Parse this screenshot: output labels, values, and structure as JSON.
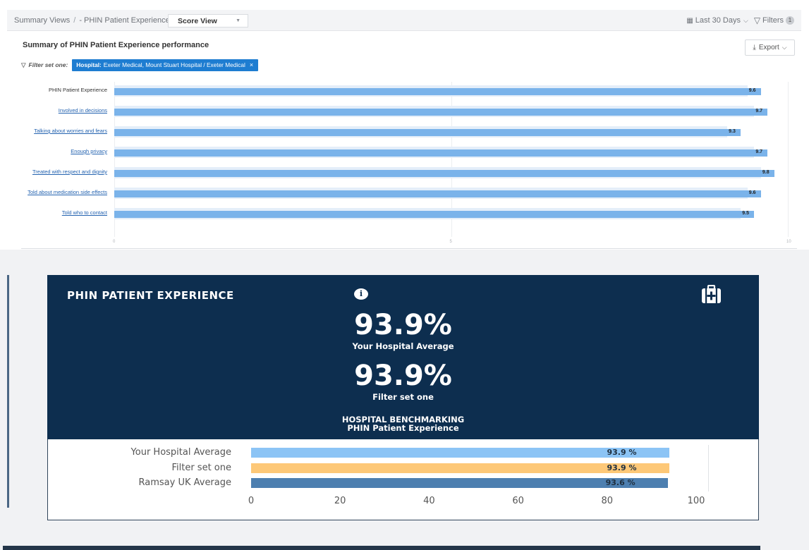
{
  "breadcrumb": {
    "root": "Summary Views",
    "sep": "/",
    "section": "- PHIN Patient Experience",
    "view_select": "Score View"
  },
  "toolbar": {
    "date_range": "Last 30 Days",
    "filters_label": "Filters",
    "filters_count": "1"
  },
  "summary": {
    "title": "Summary of PHIN Patient Experience performance",
    "export_label": "Export",
    "filter_label": "Filter set one:",
    "filter_chip_key": "Hospital:",
    "filter_chip_value": "Exeter Medical, Mount Stuart Hospital / Exeter Medical",
    "filter_chip_remove": "×"
  },
  "chart_data": [
    {
      "type": "bar",
      "orientation": "horizontal",
      "categories": [
        "PHIN Patient Experience",
        "Involved in decisions",
        "Talking about worries and fears",
        "Enough privacy",
        "Treated with respect and dignity",
        "Told about medication side effects",
        "Told who to contact"
      ],
      "values": [
        9.6,
        9.7,
        9.3,
        9.7,
        9.8,
        9.6,
        9.5
      ],
      "value_labels": [
        "9.6",
        "9.7",
        "9.3",
        "9.7",
        "9.8",
        "9.6",
        "9.5"
      ],
      "xlim": [
        0,
        10
      ],
      "x_ticks": [
        "0",
        "5",
        "10"
      ],
      "colors": {
        "bar": "#7ab3ea",
        "background": "#e4eef9"
      }
    },
    {
      "type": "bar",
      "orientation": "horizontal",
      "categories": [
        "Your Hospital Average",
        "Filter set one",
        "Ramsay UK Average"
      ],
      "values": [
        93.9,
        93.9,
        93.6
      ],
      "value_labels": [
        "93.9 %",
        "93.9 %",
        "93.6 %"
      ],
      "xlim": [
        0,
        100
      ],
      "x_ticks": [
        "0",
        "20",
        "40",
        "60",
        "80",
        "100"
      ],
      "colors": [
        "#8cc4f5",
        "#fdc878",
        "#4d7fb0"
      ]
    }
  ],
  "kpi": {
    "title": "PHIN PATIENT EXPERIENCE",
    "info_icon": "i",
    "hospital_value": "93.9%",
    "hospital_label": "Your Hospital Average",
    "filter_value": "93.9%",
    "filter_label": "Filter set one",
    "bench_title_1": "HOSPITAL BENCHMARKING",
    "bench_title_2": "PHIN Patient Experience",
    "colors": {
      "card_bg": "#0d2e4f"
    }
  }
}
